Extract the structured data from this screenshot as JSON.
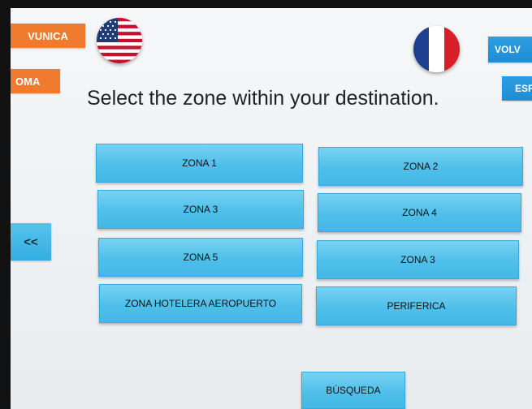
{
  "top_left_buttons": {
    "unica_label": "VUNICA",
    "oma_label": "OMA"
  },
  "top_right_buttons": {
    "volver_label": "VOLV",
    "esp_label": "ESP"
  },
  "flags": {
    "english": "us-flag-icon",
    "french": "france-flag-icon"
  },
  "headline": "Select the zone within your destination.",
  "back_label": "<<",
  "zones": [
    {
      "label": "ZONA 1"
    },
    {
      "label": "ZONA 2"
    },
    {
      "label": "ZONA 3"
    },
    {
      "label": "ZONA 4"
    },
    {
      "label": "ZONA 5"
    },
    {
      "label": "ZONA 3"
    },
    {
      "label": "ZONA HOTELERA AEROPUERTO"
    },
    {
      "label": "PERIFERICA"
    }
  ],
  "search_label": "BÚSQUEDA",
  "colors": {
    "orange": "#f07a2e",
    "button_blue": "#4fbfea",
    "nav_blue": "#1f8cd4"
  }
}
